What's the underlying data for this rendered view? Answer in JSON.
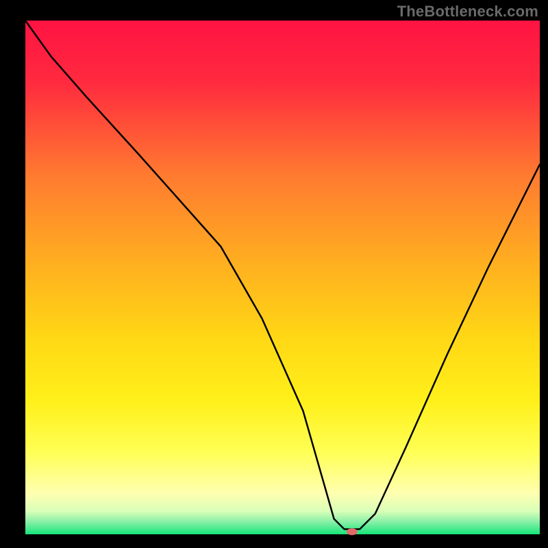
{
  "watermark": "TheBottleneck.com",
  "chart_data": {
    "type": "line",
    "title": "",
    "xlabel": "",
    "ylabel": "",
    "xlim": [
      0,
      100
    ],
    "ylim": [
      0,
      100
    ],
    "grid": false,
    "legend": false,
    "background_gradient": {
      "direction": "vertical",
      "stops": [
        {
          "pos": 0.0,
          "color": "#ff1342"
        },
        {
          "pos": 0.12,
          "color": "#ff2a3f"
        },
        {
          "pos": 0.3,
          "color": "#ff7a30"
        },
        {
          "pos": 0.48,
          "color": "#ffb11f"
        },
        {
          "pos": 0.62,
          "color": "#ffd815"
        },
        {
          "pos": 0.74,
          "color": "#fff01a"
        },
        {
          "pos": 0.84,
          "color": "#ffff55"
        },
        {
          "pos": 0.92,
          "color": "#ffffb0"
        },
        {
          "pos": 0.955,
          "color": "#d9ffb8"
        },
        {
          "pos": 0.975,
          "color": "#8cf0a8"
        },
        {
          "pos": 1.0,
          "color": "#15e67a"
        }
      ]
    },
    "series": [
      {
        "name": "bottleneck-curve",
        "color": "#000000",
        "width": 2.5,
        "x": [
          0,
          5,
          12,
          22,
          30,
          38,
          46,
          54,
          58,
          60,
          62,
          65,
          68,
          74,
          82,
          90,
          100
        ],
        "y": [
          100,
          93,
          85,
          74,
          65,
          56,
          42,
          24,
          10,
          3,
          1,
          1,
          4,
          17,
          35,
          52,
          72
        ]
      }
    ],
    "marker": {
      "name": "optimal-point",
      "x": 63.5,
      "y": 0.5,
      "color": "#e26a6a",
      "rx": 8,
      "ry": 5
    }
  }
}
